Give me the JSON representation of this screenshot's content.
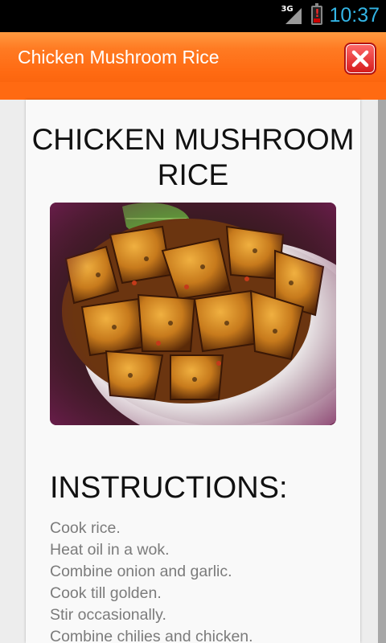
{
  "status_bar": {
    "network_label": "3G",
    "network_icon": "signal-icon",
    "battery_icon": "battery-alert-icon",
    "time": "10:37",
    "clock_color": "#33b5e5"
  },
  "title_bar": {
    "title": "Chicken Mushroom Rice",
    "close_icon": "close-icon",
    "bar_color": "#ff6a12"
  },
  "recipe": {
    "title": "CHICKEN MUSHROOM RICE",
    "instructions_heading": "INSTRUCTIONS:",
    "steps": [
      "Cook rice.",
      "Heat oil in a wok.",
      "Combine onion and garlic.",
      "Cook till golden.",
      "Stir occasionally.",
      "Combine chilies and chicken."
    ]
  }
}
